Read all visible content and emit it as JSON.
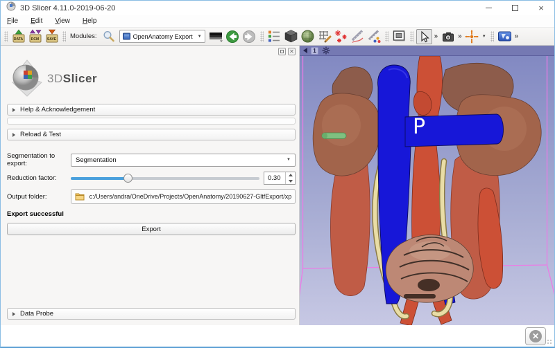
{
  "window": {
    "title": "3D Slicer 4.11.0-2019-06-20",
    "close": "×"
  },
  "menu": {
    "items": [
      "File",
      "Edit",
      "View",
      "Help"
    ]
  },
  "toolbar": {
    "load_buttons": [
      {
        "label": "DATA"
      },
      {
        "label": "DCM"
      },
      {
        "label": "SAVE"
      }
    ],
    "modules_label": "Modules:",
    "module_selector": {
      "value": "OpenAnatomy Export",
      "caret": "▼"
    },
    "overflow": "»",
    "crosshair_caret": "▼"
  },
  "panel": {
    "logo": {
      "text_3d": "3D",
      "text_slicer": "Slicer"
    },
    "sections": {
      "help": "Help & Acknowledgement",
      "reload": "Reload & Test",
      "data_probe": "Data Probe"
    },
    "form": {
      "segmentation_label": "Segmentation to export:",
      "segmentation_value": "Segmentation",
      "reduction_label": "Reduction factor:",
      "reduction_value": "0.30",
      "output_label": "Output folder:",
      "output_path": "c:/Users/andra/OneDrive/Projects/OpenAnatomy/20190627-GltfExport/xp",
      "status_message": "Export successful",
      "export_label": "Export"
    }
  },
  "viewport": {
    "view_index": "1",
    "orientation_label": "P"
  },
  "colors": {
    "slider_fill": "#4aa0dd",
    "window_border": "#8abde4",
    "viewport_top": "#8289c2",
    "viewport_bottom": "#c7c8e4",
    "view_controller_bar": "#7579b3",
    "bounding_box_pink": "#ee79e6",
    "aorta_red": "#cc5036",
    "vein_blue": "#1717d8",
    "ureter_tan": "#e9dda6",
    "kidney_brown": "#a2644b",
    "muscle_salmon": "#c05c46",
    "sacrum_pink": "#bd8875",
    "green_marker": "#7fc080"
  }
}
